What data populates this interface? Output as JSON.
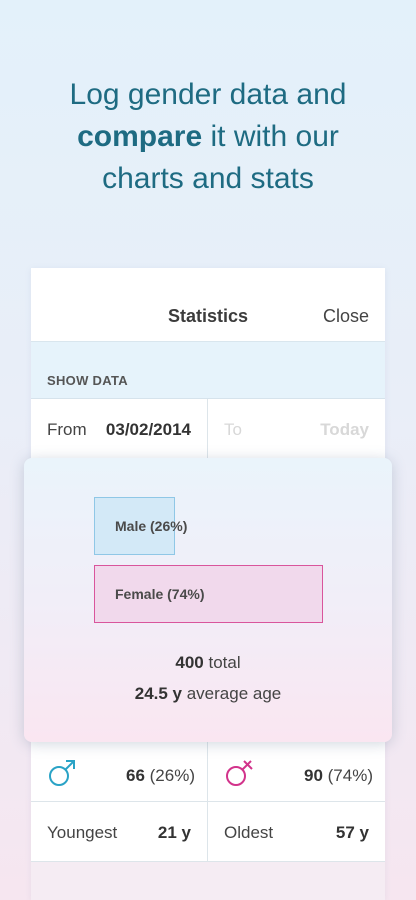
{
  "headline": {
    "line1": "Log gender data and",
    "emphasis": "compare",
    "line2_rest": " it with our",
    "line3": "charts and stats"
  },
  "header": {
    "title": "Statistics",
    "close_label": "Close"
  },
  "section": {
    "show_data_label": "SHOW DATA"
  },
  "date_range": {
    "from_label": "From",
    "from_value": "03/02/2014",
    "to_label": "To",
    "to_value": "Today"
  },
  "chart": {
    "male_label": "Male (26%)",
    "male_fraction": 0.26,
    "female_label": "Female (74%)",
    "female_fraction": 0.74,
    "total_value": "400",
    "total_suffix": " total",
    "avg_value": "24.5 y",
    "avg_suffix": " average age"
  },
  "stats": {
    "male_icon": "male-symbol-icon",
    "male_count": "66",
    "male_percent": " (26%)",
    "female_icon": "female-symbol-icon",
    "female_count": "90",
    "female_percent": " (74%)",
    "youngest_label": "Youngest",
    "youngest_value": "21 y",
    "oldest_label": "Oldest",
    "oldest_value": "57 y"
  },
  "colors": {
    "headline": "#1e6b82",
    "male_accent": "#2aa3c6",
    "female_accent": "#d2338b"
  }
}
